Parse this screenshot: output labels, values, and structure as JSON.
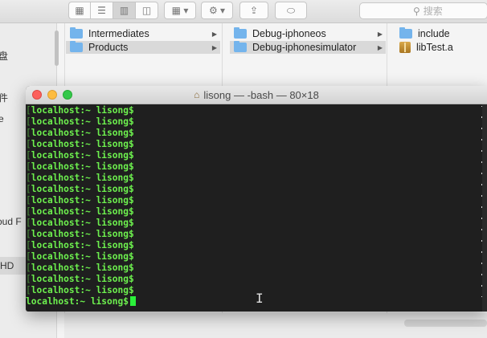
{
  "finder": {
    "search_placeholder": "搜索",
    "icons": [
      "grid-view-icon",
      "list-view-icon",
      "column-view-icon",
      "cover-flow-icon",
      "arrange-icon",
      "gear-icon",
      "share-icon",
      "tag-icon",
      "search-icon"
    ],
    "sidebar": {
      "items": [
        "盘",
        "件",
        "e",
        "oud F",
        "HD"
      ]
    },
    "columns": [
      {
        "rows": [
          {
            "label": "Intermediates",
            "type": "folder",
            "selected": false
          },
          {
            "label": "Products",
            "type": "folder",
            "selected": true
          }
        ]
      },
      {
        "rows": [
          {
            "label": "Debug-iphoneos",
            "type": "folder",
            "selected": false
          },
          {
            "label": "Debug-iphonesimulator",
            "type": "folder",
            "selected": true
          }
        ]
      },
      {
        "rows": [
          {
            "label": "include",
            "type": "folder",
            "selected": false
          },
          {
            "label": "libTest.a",
            "type": "archive",
            "selected": false
          }
        ]
      }
    ]
  },
  "terminal": {
    "title": "lisong — -bash — 80×18",
    "prompt": "localhost:~ lisong$",
    "line_count": 18,
    "colors": {
      "text": "#6df04e",
      "background": "#1f1f1f",
      "cursor": "#2bf03a"
    }
  }
}
